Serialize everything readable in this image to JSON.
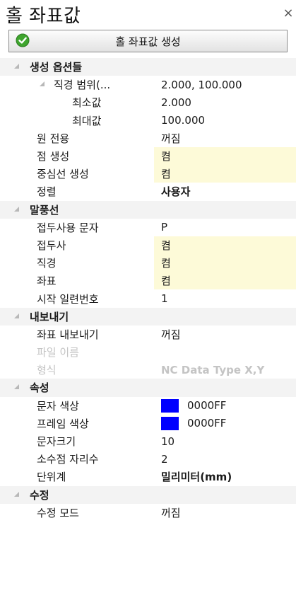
{
  "title": "홀 좌표값",
  "close_label": "×",
  "generate_button": "홀 좌표값 생성",
  "colors": {
    "swatch": "#0000FF",
    "accent_ok": "#3fa52e",
    "highlight": "#fdfad8"
  },
  "icons": {
    "ok": "check-circle-icon",
    "close": "close-icon",
    "expand": "collapse-triangle-icon"
  },
  "rows": [
    {
      "kind": "cat",
      "label": "생성 옵션들"
    },
    {
      "kind": "sub",
      "label": "직경 범위(...",
      "value": "2.000, 100.000"
    },
    {
      "kind": "prop",
      "indent": 2,
      "label": "최소값",
      "value": "2.000"
    },
    {
      "kind": "prop",
      "indent": 2,
      "label": "최대값",
      "value": "100.000"
    },
    {
      "kind": "prop",
      "label": "원 전용",
      "value": "꺼짐"
    },
    {
      "kind": "prop",
      "label": "점 생성",
      "value": "켬",
      "hl": true
    },
    {
      "kind": "prop",
      "label": "중심선 생성",
      "value": "켬",
      "hl": true
    },
    {
      "kind": "prop",
      "label": "정렬",
      "value": "사용자",
      "bold": true
    },
    {
      "kind": "cat",
      "label": "말풍선"
    },
    {
      "kind": "prop",
      "label": "접두사용 문자",
      "value": "P"
    },
    {
      "kind": "prop",
      "label": "접두사",
      "value": "켬",
      "hl": true
    },
    {
      "kind": "prop",
      "label": "직경",
      "value": "켬",
      "hl": true
    },
    {
      "kind": "prop",
      "label": "좌표",
      "value": "켬",
      "hl": true
    },
    {
      "kind": "prop",
      "label": "시작 일련번호",
      "value": "1"
    },
    {
      "kind": "cat",
      "label": "내보내기"
    },
    {
      "kind": "prop",
      "label": "좌표 내보내기",
      "value": "꺼짐"
    },
    {
      "kind": "prop",
      "label": "파일 이름",
      "value": "",
      "disabled": true
    },
    {
      "kind": "prop",
      "label": "형식",
      "value": "NC Data Type X,Y",
      "disabled": true,
      "bold": true
    },
    {
      "kind": "cat",
      "label": "속성"
    },
    {
      "kind": "prop",
      "label": "문자 색상",
      "value": "0000FF",
      "swatch": true
    },
    {
      "kind": "prop",
      "label": "프레임 색상",
      "value": "0000FF",
      "swatch": true
    },
    {
      "kind": "prop",
      "label": "문자크기",
      "value": "10"
    },
    {
      "kind": "prop",
      "label": "소수점 자리수",
      "value": "2"
    },
    {
      "kind": "prop",
      "label": "단위계",
      "value": "밀리미터(mm)",
      "bold": true
    },
    {
      "kind": "cat",
      "label": "수정"
    },
    {
      "kind": "prop",
      "label": "수정 모드",
      "value": "꺼짐"
    }
  ]
}
